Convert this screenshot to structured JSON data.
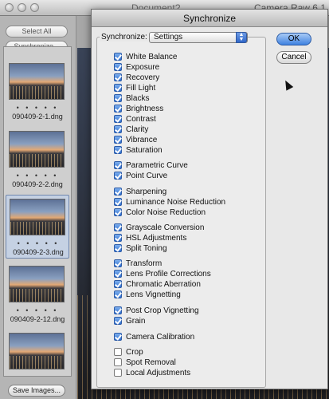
{
  "window": {
    "doc_title": "Document?",
    "app_title": "Camera Raw 6.1"
  },
  "sidebar": {
    "select_all": "Select All",
    "synchronize": "Synchronize...",
    "save_images": "Save Images..."
  },
  "filmstrip": [
    {
      "name": "090409-2-1.dng",
      "stars": "• • • • •",
      "selected": false
    },
    {
      "name": "090409-2-2.dng",
      "stars": "• • • • •",
      "selected": false
    },
    {
      "name": "090409-2-3.dng",
      "stars": "• • • • •",
      "selected": true
    },
    {
      "name": "090409-2-12.dng",
      "stars": "• • • • •",
      "selected": false
    },
    {
      "name": "",
      "stars": "",
      "selected": false
    }
  ],
  "dialog": {
    "title": "Synchronize",
    "sync_label": "Synchronize:",
    "preset_value": "Settings",
    "ok": "OK",
    "cancel": "Cancel",
    "options": [
      {
        "label": "White Balance",
        "checked": true
      },
      {
        "label": "Exposure",
        "checked": true
      },
      {
        "label": "Recovery",
        "checked": true
      },
      {
        "label": "Fill Light",
        "checked": true
      },
      {
        "label": "Blacks",
        "checked": true
      },
      {
        "label": "Brightness",
        "checked": true
      },
      {
        "label": "Contrast",
        "checked": true
      },
      {
        "label": "Clarity",
        "checked": true
      },
      {
        "label": "Vibrance",
        "checked": true
      },
      {
        "label": "Saturation",
        "checked": true
      },
      {
        "label": "Parametric Curve",
        "checked": true
      },
      {
        "label": "Point Curve",
        "checked": true
      },
      {
        "label": "Sharpening",
        "checked": true
      },
      {
        "label": "Luminance Noise Reduction",
        "checked": true
      },
      {
        "label": "Color Noise Reduction",
        "checked": true
      },
      {
        "label": "Grayscale Conversion",
        "checked": true
      },
      {
        "label": "HSL Adjustments",
        "checked": true
      },
      {
        "label": "Split Toning",
        "checked": true
      },
      {
        "label": "Transform",
        "checked": true
      },
      {
        "label": "Lens Profile Corrections",
        "checked": true
      },
      {
        "label": "Chromatic Aberration",
        "checked": true
      },
      {
        "label": "Lens Vignetting",
        "checked": true
      },
      {
        "label": "Post Crop Vignetting",
        "checked": true
      },
      {
        "label": "Grain",
        "checked": true
      },
      {
        "label": "Camera Calibration",
        "checked": true
      },
      {
        "label": "Crop",
        "checked": false
      },
      {
        "label": "Spot Removal",
        "checked": false
      },
      {
        "label": "Local Adjustments",
        "checked": false
      }
    ]
  }
}
